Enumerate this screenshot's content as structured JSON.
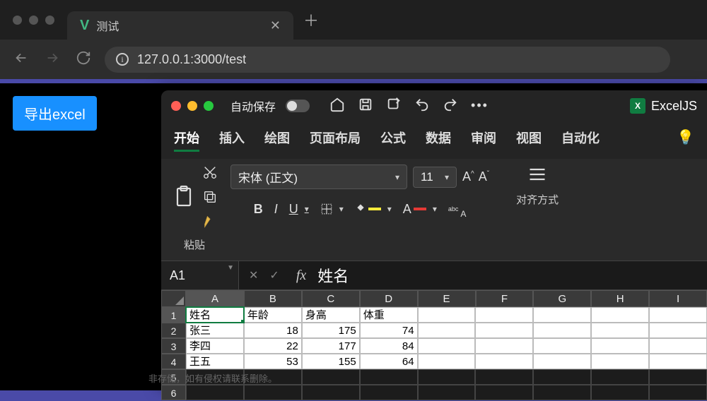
{
  "browser": {
    "tab_title": "测试",
    "url": "127.0.0.1:3000/test"
  },
  "page": {
    "export_button": "导出excel"
  },
  "excel": {
    "autosave_label": "自动保存",
    "brand": "ExcelJS",
    "ribbon_tabs": [
      "开始",
      "插入",
      "绘图",
      "页面布局",
      "公式",
      "数据",
      "审阅",
      "视图",
      "自动化"
    ],
    "active_ribbon_tab": 0,
    "paste_label": "粘贴",
    "font_name": "宋体 (正文)",
    "font_size": "11",
    "align_label": "对齐方式",
    "cell_ref": "A1",
    "fx_value": "姓名",
    "columns": [
      "A",
      "B",
      "C",
      "D",
      "E",
      "F",
      "G",
      "H",
      "I"
    ],
    "row_numbers": [
      "1",
      "2",
      "3",
      "4",
      "5",
      "6"
    ],
    "table": {
      "headers": [
        "姓名",
        "年龄",
        "身高",
        "体重"
      ],
      "rows": [
        {
          "name": "张三",
          "age": 18,
          "height": 175,
          "weight": 74
        },
        {
          "name": "李四",
          "age": 22,
          "height": 177,
          "weight": 84
        },
        {
          "name": "王五",
          "age": 53,
          "height": 155,
          "weight": 64
        }
      ]
    }
  },
  "watermark": "非存储，如有侵权请联系删除。"
}
